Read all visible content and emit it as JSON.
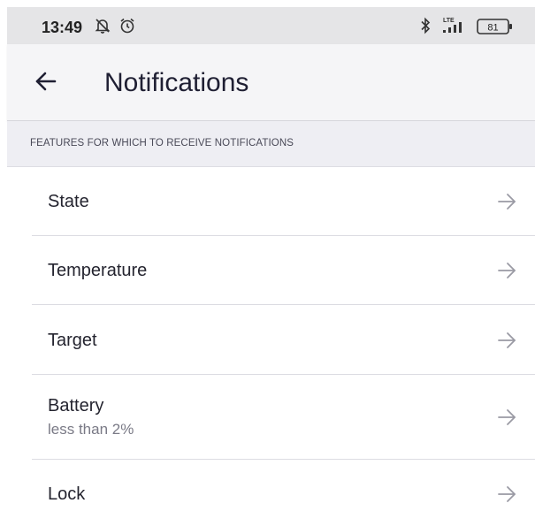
{
  "status_bar": {
    "time": "13:49",
    "icons": [
      "notifications-off-icon",
      "alarm-icon",
      "bluetooth-icon",
      "lte-signal-icon",
      "battery-icon"
    ],
    "network": "LTE",
    "battery_level": "81"
  },
  "app_bar": {
    "back_icon": "arrow-left-icon",
    "title": "Notifications"
  },
  "section": {
    "header": "FEATURES FOR WHICH TO RECEIVE NOTIFICATIONS"
  },
  "items": [
    {
      "label": "State",
      "sublabel": ""
    },
    {
      "label": "Temperature",
      "sublabel": ""
    },
    {
      "label": "Target",
      "sublabel": ""
    },
    {
      "label": "Battery",
      "sublabel": "less than 2%"
    },
    {
      "label": "Lock",
      "sublabel": ""
    }
  ],
  "colors": {
    "status_bar_bg": "#e5e5e7",
    "app_bar_bg": "#f5f5f7",
    "section_bg": "#eeeef3",
    "chevron": "#9a9aa4"
  }
}
